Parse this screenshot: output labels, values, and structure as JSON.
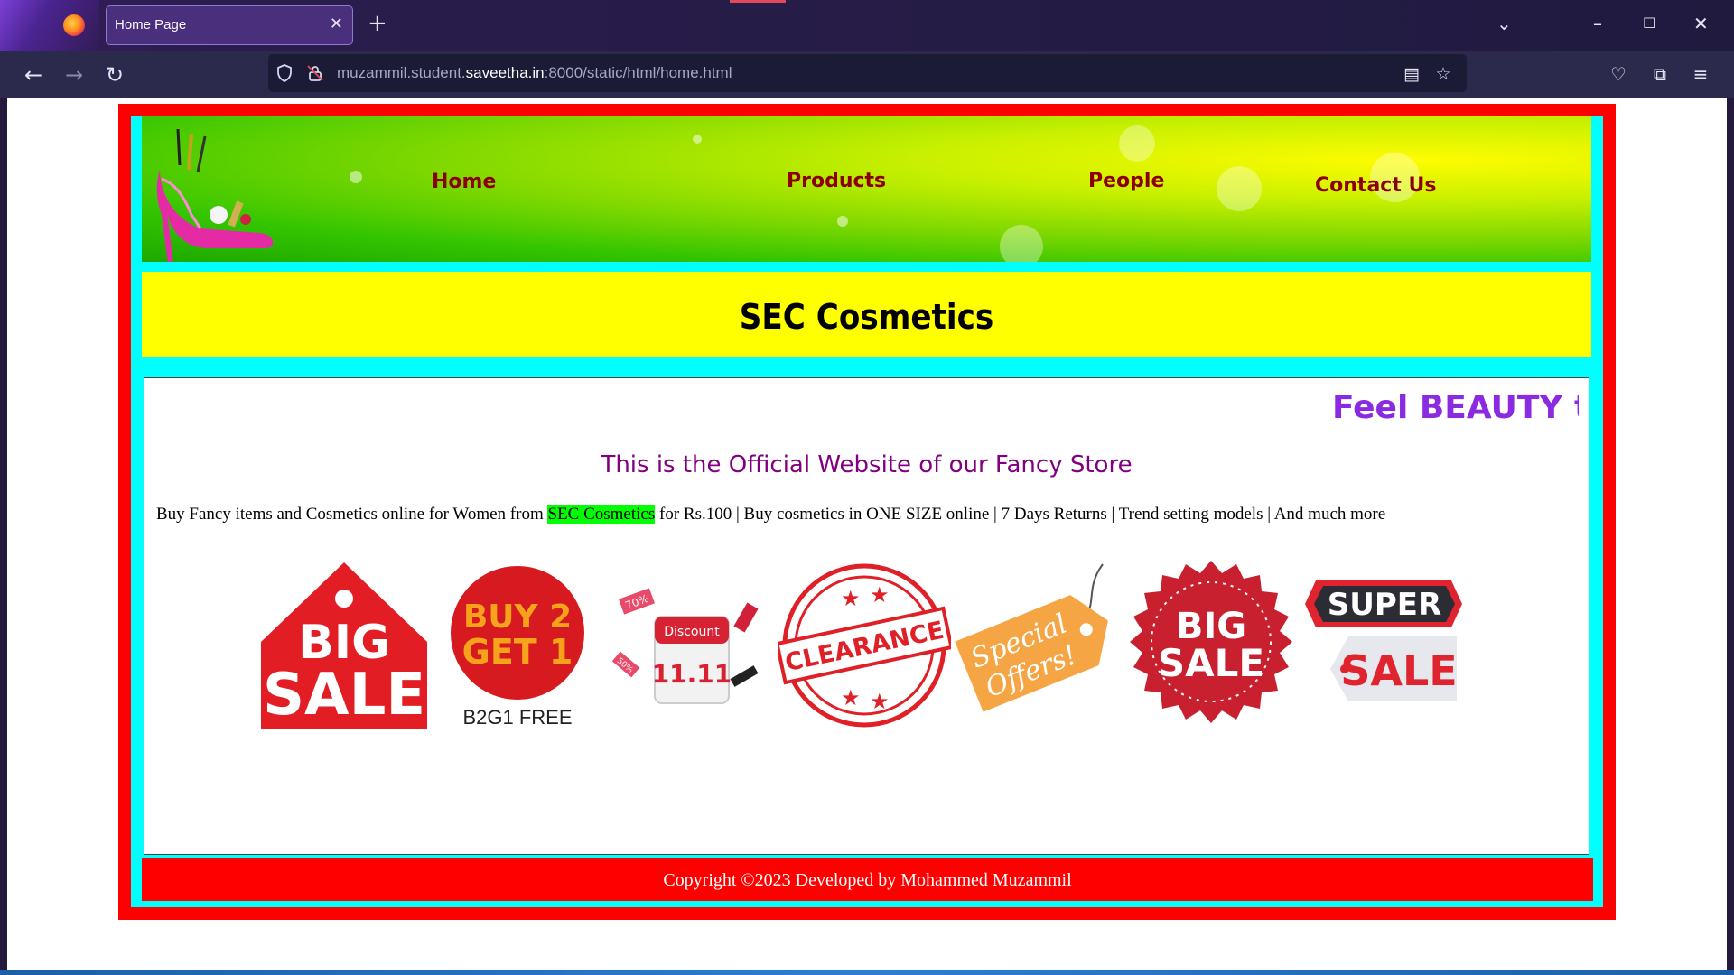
{
  "browser": {
    "tab_title": "Home Page",
    "tab_close": "✕",
    "new_tab": "+",
    "url_host_prefix": "muzammil.student.",
    "url_host_domain": "saveetha.in",
    "url_rest": ":8000/static/html/home.html"
  },
  "nav": {
    "home": "Home",
    "products": "Products",
    "people": "People",
    "contact": "Contact Us"
  },
  "banner": {
    "title": "SEC Cosmetics"
  },
  "content": {
    "marquee": "Feel BEAUTY th",
    "subtitle": "This is the Official Website of our Fancy Store",
    "desc_before": "Buy Fancy items and Cosmetics online for Women from ",
    "desc_highlight": "SEC Cosmetics",
    "desc_after": " for Rs.100 | Buy cosmetics in ONE SIZE online | 7 Days Returns | Trend setting models | And much more"
  },
  "badges": {
    "big_sale_1": {
      "line1": "BIG",
      "line2": "SALE"
    },
    "buy2get1": {
      "line1": "BUY 2",
      "line2": "GET 1",
      "caption": "B2G1 FREE"
    },
    "discount": {
      "label": "Discount",
      "date": "11.11",
      "tag1": "70%",
      "tag2": "50%"
    },
    "clearance": {
      "text": "CLEARANCE"
    },
    "special": {
      "line1": "Special",
      "line2": "Offers!"
    },
    "big_sale_2": {
      "line1": "BIG",
      "line2": "SALE"
    },
    "super_sale": {
      "line1": "SUPER",
      "line2": "SALE"
    }
  },
  "footer": {
    "copyright": "Copyright ©2023 Developed by Mohammed Muzammil"
  },
  "colors": {
    "frame": "#ff0000",
    "inner": "#00ffff",
    "banner": "#ffff00",
    "nav_text": "#8b0000",
    "marquee": "#8a2be2",
    "subtitle": "#800080",
    "highlight": "#00ff00"
  }
}
